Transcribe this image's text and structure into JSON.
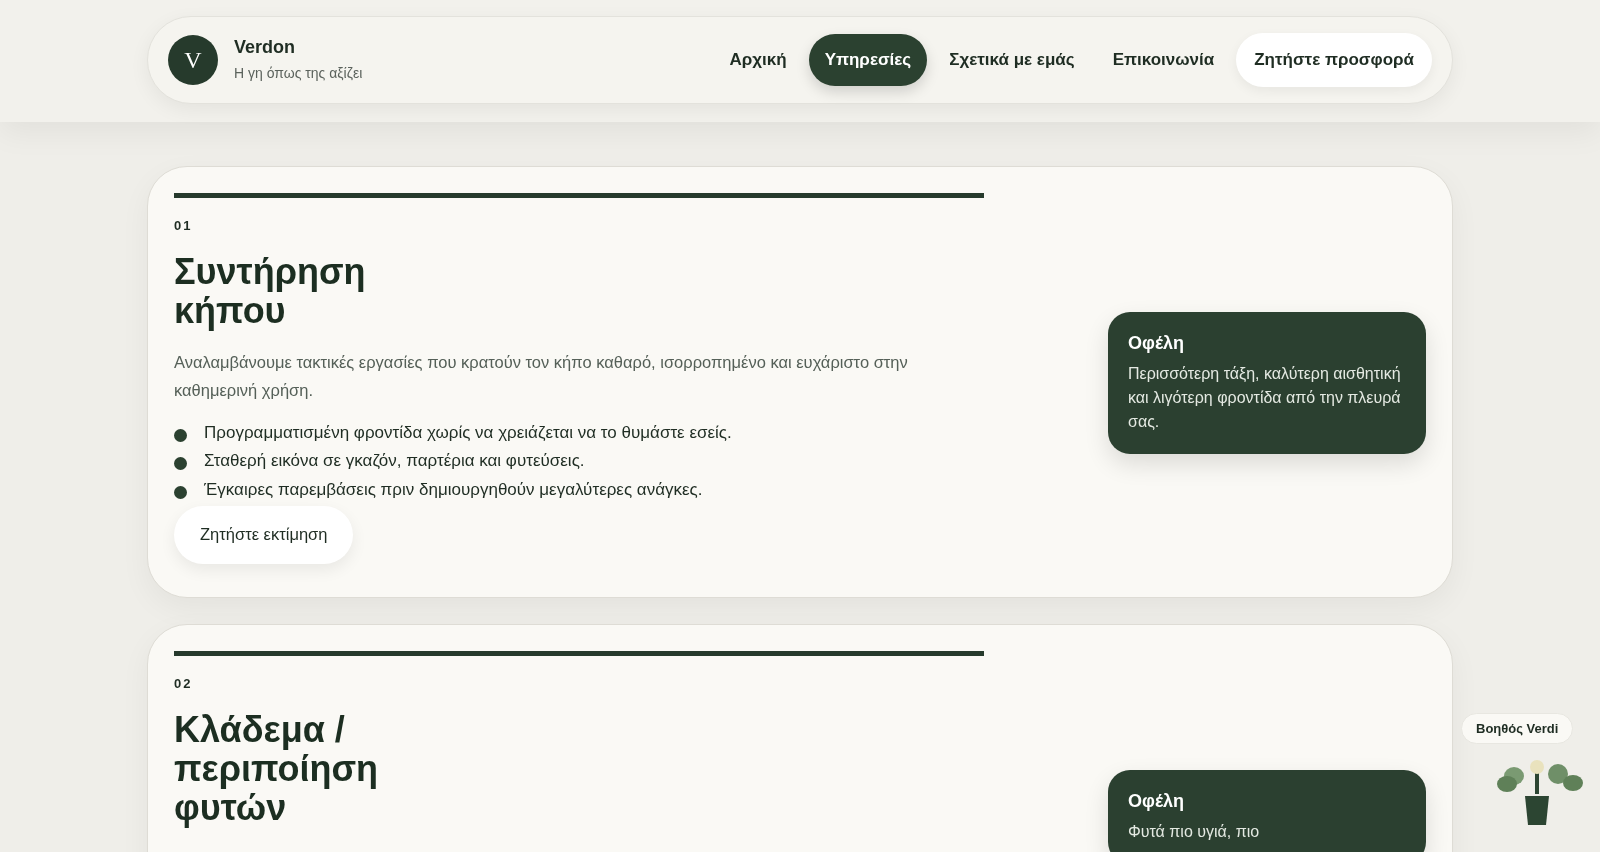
{
  "brand": {
    "initial": "V",
    "name": "Verdon",
    "tagline": "Η γη όπως της αξίζει"
  },
  "nav": [
    {
      "label": "Αρχική",
      "selected": false
    },
    {
      "label": "Υπηρεσίες",
      "selected": true
    },
    {
      "label": "Σχετικά με εμάς",
      "selected": false
    },
    {
      "label": "Επικοινωνία",
      "selected": false
    }
  ],
  "cta": "Ζητήστε προσφορά",
  "services": [
    {
      "number": "01",
      "title": "Συντήρηση\nκήπου",
      "description": "Αναλαμβάνουμε τακτικές εργασίες που κρατούν τον κήπο καθαρό, ισορροπημένο και ευχάριστο στην καθημερινή χρήση.",
      "bullets": [
        "Προγραμματισμένη φροντίδα χωρίς να χρειάζεται να το θυμάστε εσείς.",
        "Σταθερή εικόνα σε γκαζόν, παρτέρια και φυτεύσεις.",
        "Έγκαιρες παρεμβάσεις πριν δημιουργηθούν μεγαλύτερες ανάγκες."
      ],
      "button": "Ζητήστε εκτίμηση",
      "benefit": {
        "title": "Οφέλη",
        "text": "Περισσότερη τάξη, καλύτερη αισθητική και λιγότερη φροντίδα από την πλευρά σας."
      }
    },
    {
      "number": "02",
      "title": "Κλάδεμα /\nπεριποίηση\nφυτών",
      "benefit": {
        "title": "Οφέλη",
        "text": "Φυτά πιο υγιά, πιο"
      }
    }
  ],
  "assistant": {
    "label": "Βοηθός Verdi"
  }
}
